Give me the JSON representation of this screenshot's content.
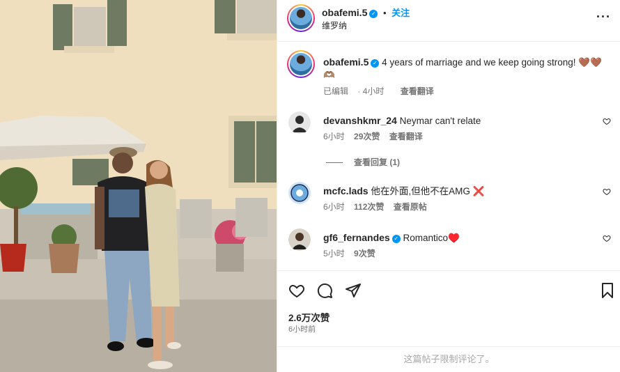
{
  "post": {
    "username": "obafemi.5",
    "follow_label": "关注",
    "location": "维罗纳",
    "more_label": "···"
  },
  "caption": {
    "username": "obafemi.5",
    "text": "4 years of marriage and we keep going strong! 🤎🤎 🫶🏽",
    "edited": "已编辑",
    "time": "4小时",
    "translate": "查看翻译"
  },
  "comments": [
    {
      "username": "devanshkmr_24",
      "text": "Neymar can't relate",
      "time": "6小时",
      "likes": "29次赞",
      "action": "查看翻译",
      "verified": false
    },
    {
      "username": "mcfc.lads",
      "text": "他在外面,但他不在AMG ❌",
      "time": "6小时",
      "likes": "112次赞",
      "action": "查看原帖",
      "verified": false
    },
    {
      "username": "gf6_fernandes",
      "text": "Romantico♥️",
      "time": "5小时",
      "likes": "9次赞",
      "action": "",
      "verified": true
    }
  ],
  "replies_label": "查看回复 (1)",
  "footer": {
    "likes": "2.6万次赞",
    "time_ago": "6小时前",
    "comments_limited": "这篇帖子限制评论了。"
  },
  "icons": [
    "more-icon",
    "verified-badge-icon",
    "heart-icon",
    "comment-icon",
    "share-icon",
    "save-icon"
  ],
  "colors": {
    "accent": "#0095f6",
    "meta": "#737373",
    "text": "#262626",
    "heart_red": "#ed4956"
  }
}
